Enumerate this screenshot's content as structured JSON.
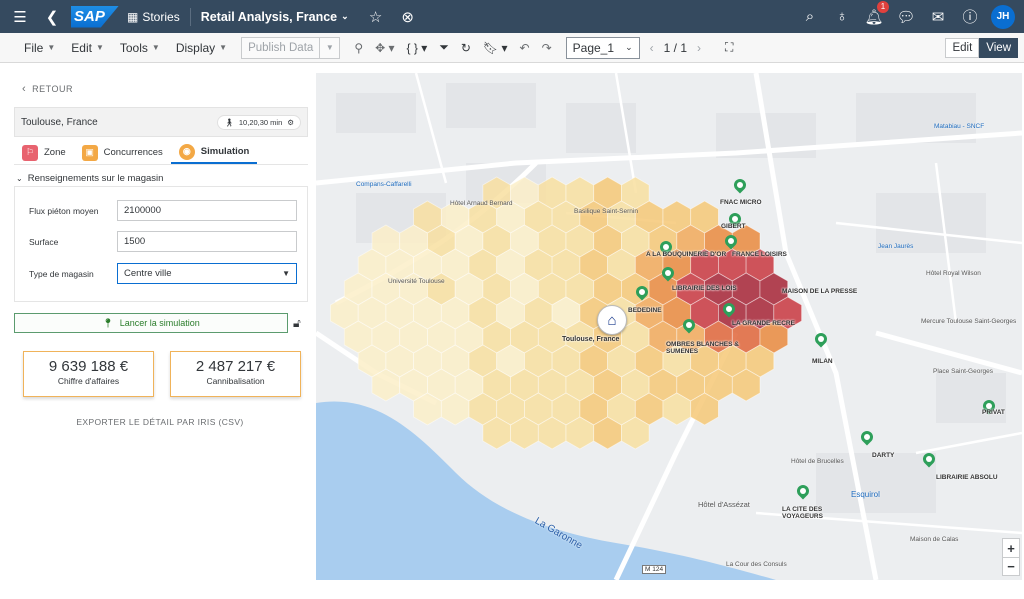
{
  "shell": {
    "logo": "SAP",
    "stories_label": "Stories",
    "story_title": "Retail Analysis, France",
    "notification_count": "1",
    "avatar_initials": "JH"
  },
  "toolbar": {
    "file": "File",
    "edit": "Edit",
    "tools": "Tools",
    "display": "Display",
    "publish": "Publish Data",
    "page": "Page_1",
    "pager": "1 / 1",
    "mode_edit": "Edit",
    "mode_view": "View"
  },
  "panel": {
    "back_label": "RETOUR",
    "location": "Toulouse, France",
    "time": "10,20,30 min",
    "tabs": [
      {
        "label": "Zone",
        "color": "#e8636f"
      },
      {
        "label": "Concurrences",
        "color": "#f3a845"
      },
      {
        "label": "Simulation",
        "color": "#f3a845"
      }
    ],
    "section_title": "Renseignements sur le magasin",
    "fields": {
      "flux_label": "Flux piéton moyen",
      "flux_value": "2100000",
      "surface_label": "Surface",
      "surface_value": "1500",
      "type_label": "Type de magasin",
      "type_value": "Centre ville"
    },
    "launch_label": "Lancer la simulation",
    "kpis": [
      {
        "value": "9 639 188 €",
        "label": "Chiffre d'affaires"
      },
      {
        "value": "2 487 217 €",
        "label": "Cannibalisation"
      }
    ],
    "export_label": "EXPORTER LE DÉTAIL PAR IRIS (CSV)"
  },
  "map": {
    "store_label": "Toulouse, France",
    "competitors": [
      {
        "name": "FNAC MICRO"
      },
      {
        "name": "GIBERT"
      },
      {
        "name": "FRANCE LOISIRS"
      },
      {
        "name": "A LA BOUQUINERIE D'OR"
      },
      {
        "name": "LIBRAIRIE DES LOIS"
      },
      {
        "name": "MAISON DE LA PRESSE"
      },
      {
        "name": "BEDEDINE"
      },
      {
        "name": "LA GRANDE RECRE"
      },
      {
        "name": "OMBRES BLANCHES & SUMENES"
      },
      {
        "name": "MILAN"
      },
      {
        "name": "DARTY"
      },
      {
        "name": "LIBRAIRIE ABSOLU"
      },
      {
        "name": "LA CITE DES VOYAGEURS"
      },
      {
        "name": "PRIVAT"
      }
    ],
    "labels": {
      "river": "La Garonne",
      "road": "M 124",
      "h1": "Hôtel de Brucelles",
      "h2": "Esquirol",
      "h3": "Hôtel d'Assézat",
      "h4": "Maison de Calas",
      "h5": "La Cour des Consuls",
      "h6": "Mercure Toulouse Saint-Georges",
      "h7": "Place Saint-Georges",
      "h8": "Jean Jaurès",
      "h9": "Hôtel Royal Wilson",
      "h10": "Université Toulouse",
      "h11": "Compans-Caffarelli",
      "h12": "Basilique Saint-Sernin",
      "h13": "Hôtel Arnaud Bernard",
      "h14": "Matabiau - SNCF",
      "zoom_in": "+",
      "zoom_out": "−"
    }
  }
}
